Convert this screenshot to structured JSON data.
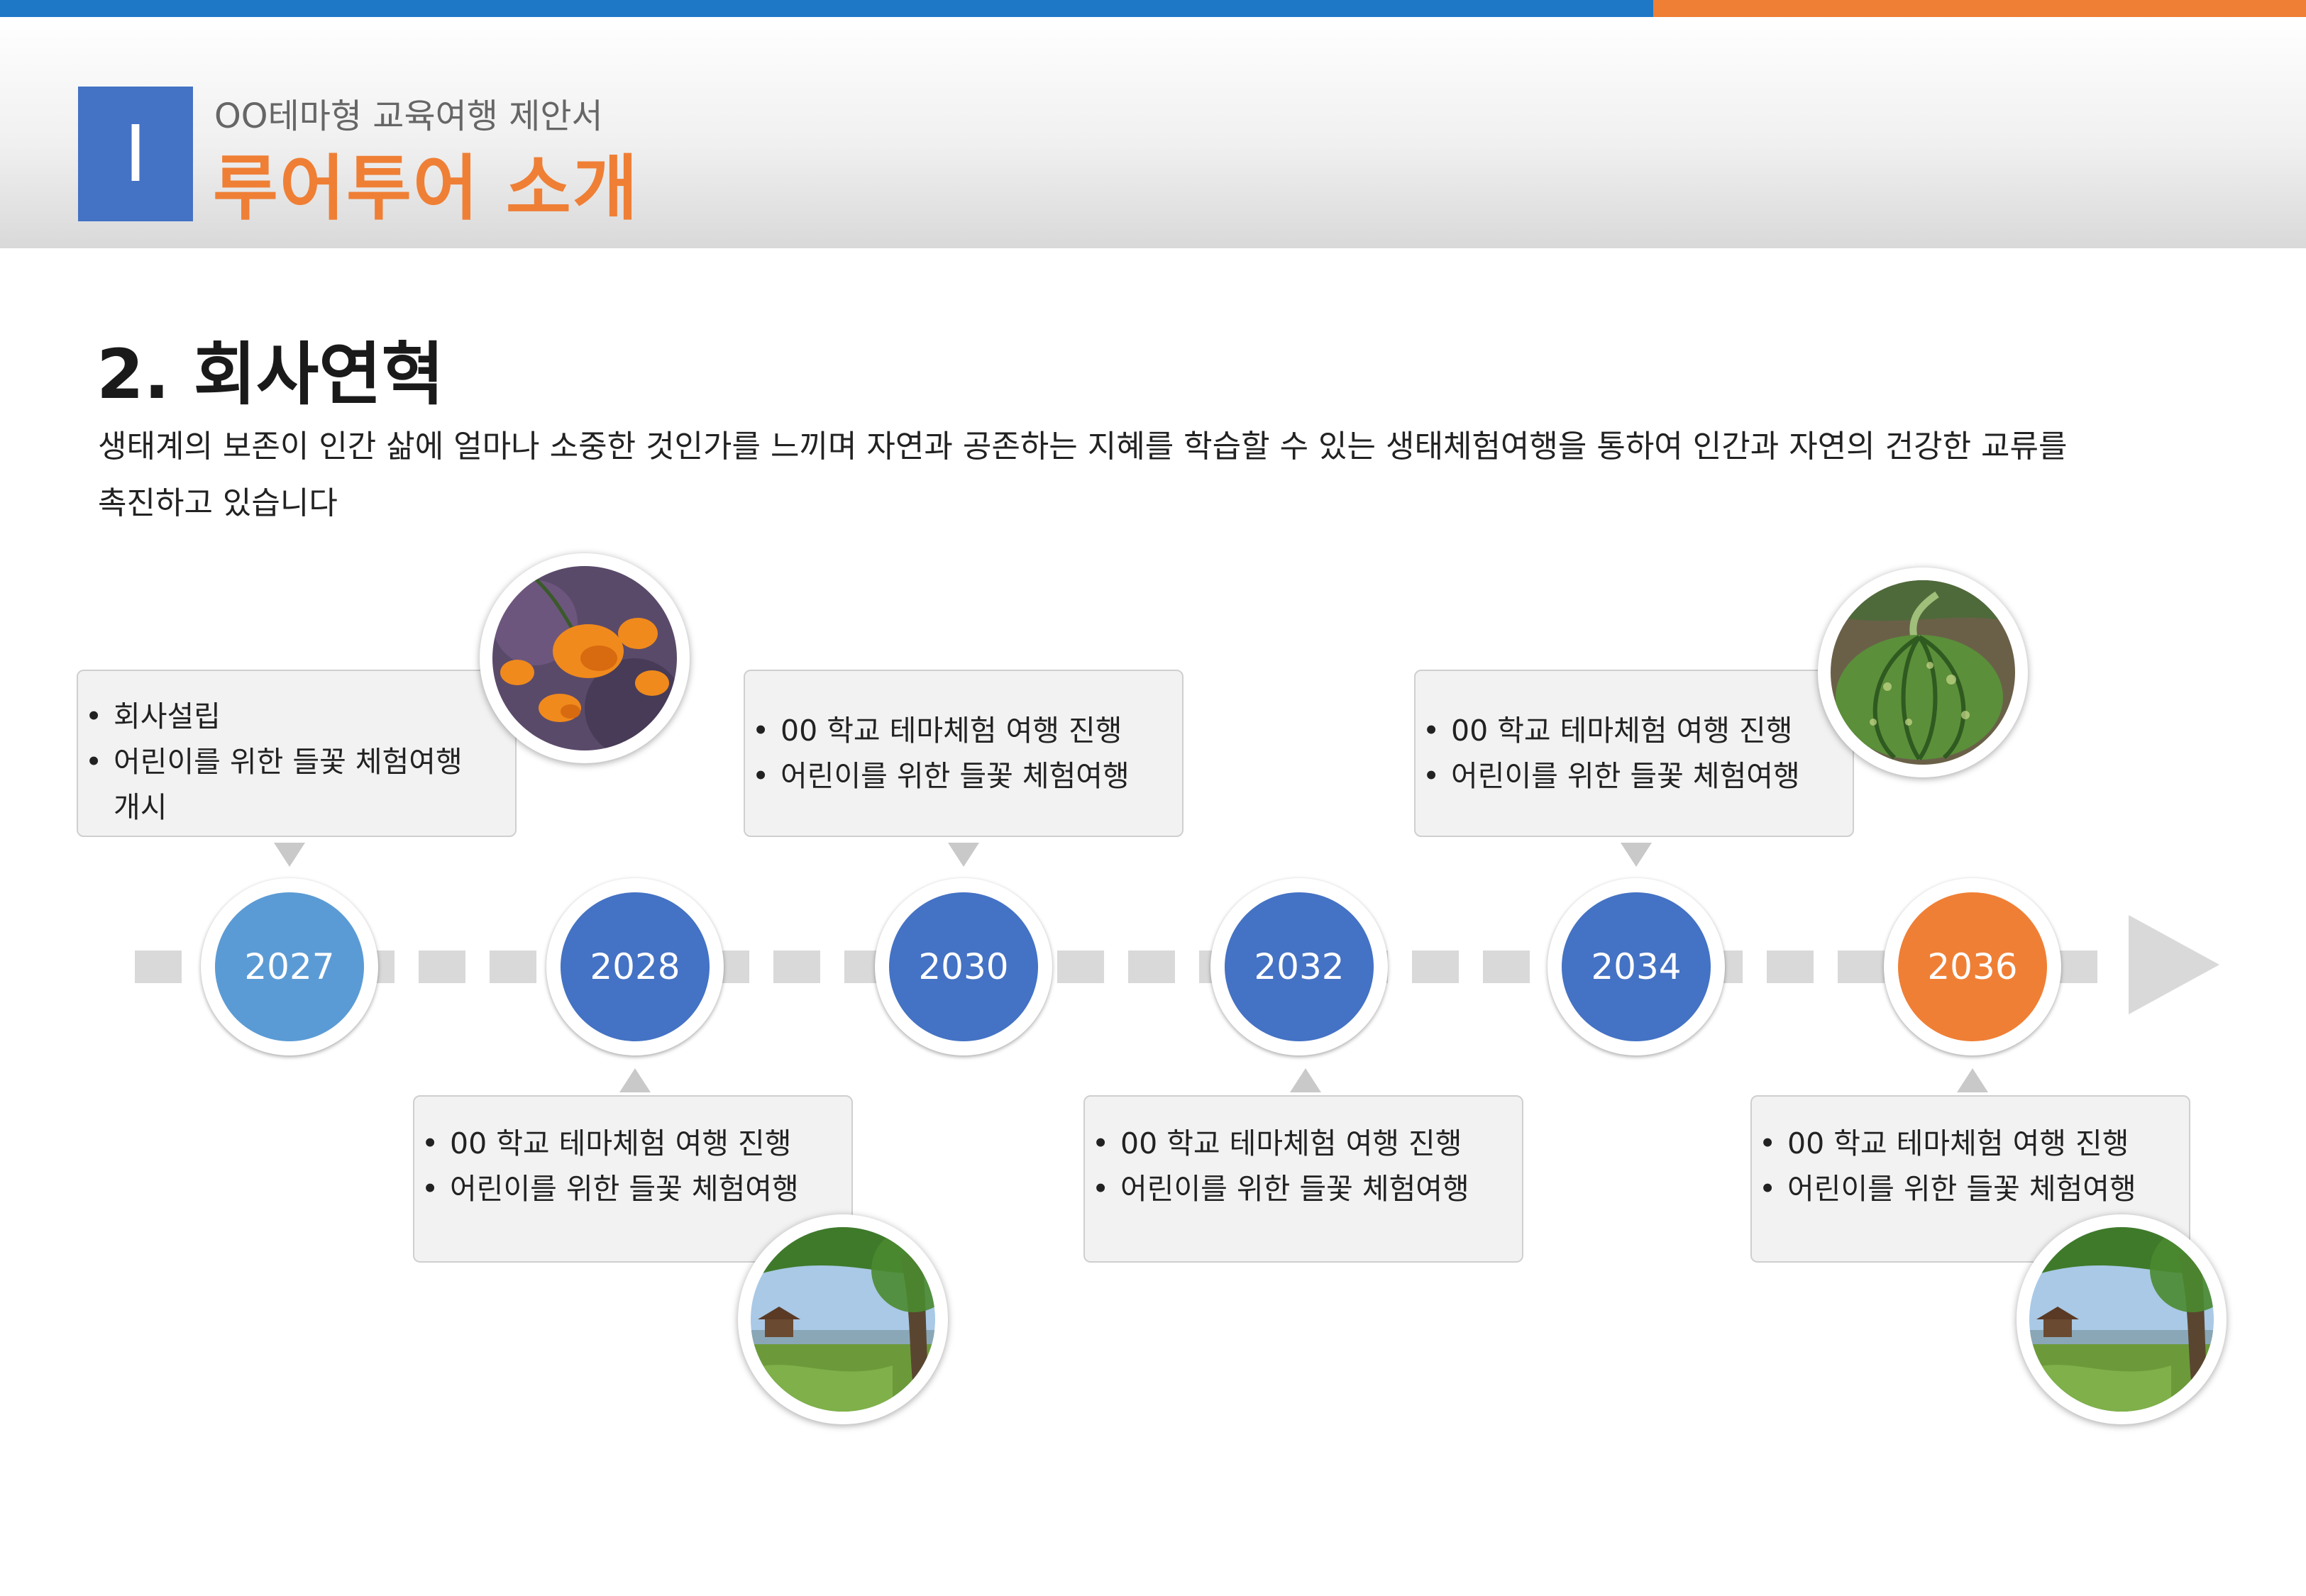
{
  "header": {
    "chapter_numeral": "I",
    "subtitle": "OO테마형 교육여행 제안서",
    "title": "루어투어 소개"
  },
  "section": {
    "title": "2. 회사연혁",
    "intro_line1": "생태계의 보존이 인간 삶에 얼마나 소중한 것인가를 느끼며 자연과 공존하는 지혜를 학습할 수 있는 생태체험여행을  통하여 인간과 자연의 건강한 교류를",
    "intro_line2": "촉진하고 있습니다"
  },
  "colors": {
    "blue_light": "#5b9bd5",
    "blue": "#4472c4",
    "orange": "#ef7f35",
    "track": "#d9d9d9"
  },
  "timeline": {
    "years": [
      "2027",
      "2028",
      "2030",
      "2032",
      "2034",
      "2036"
    ],
    "cards": [
      {
        "year": "2027",
        "items": [
          "회사설립",
          "어린이를 위한 들꽃 체험여행",
          "개시"
        ]
      },
      {
        "year": "2028",
        "items": [
          "00 학교 테마체험 여행 진행",
          "어린이를 위한 들꽃 체험여행"
        ]
      },
      {
        "year": "2030",
        "items": [
          "00 학교 테마체험 여행 진행",
          "어린이를 위한 들꽃 체험여행"
        ]
      },
      {
        "year": "2032",
        "items": [
          "00 학교 테마체험 여행 진행",
          "어린이를 위한 들꽃 체험여행"
        ]
      },
      {
        "year": "2034",
        "items": [
          "00 학교 테마체험 여행 진행",
          "어린이를 위한 들꽃 체험여행"
        ]
      },
      {
        "year": "2036",
        "items": [
          "00 학교 테마체험 여행 진행",
          "어린이를 위한 들꽃 체험여행"
        ]
      }
    ]
  },
  "photos": [
    "orange-flower-photo",
    "landscape-tree-photo",
    "pumpkin-photo",
    "landscape-tree-photo"
  ]
}
